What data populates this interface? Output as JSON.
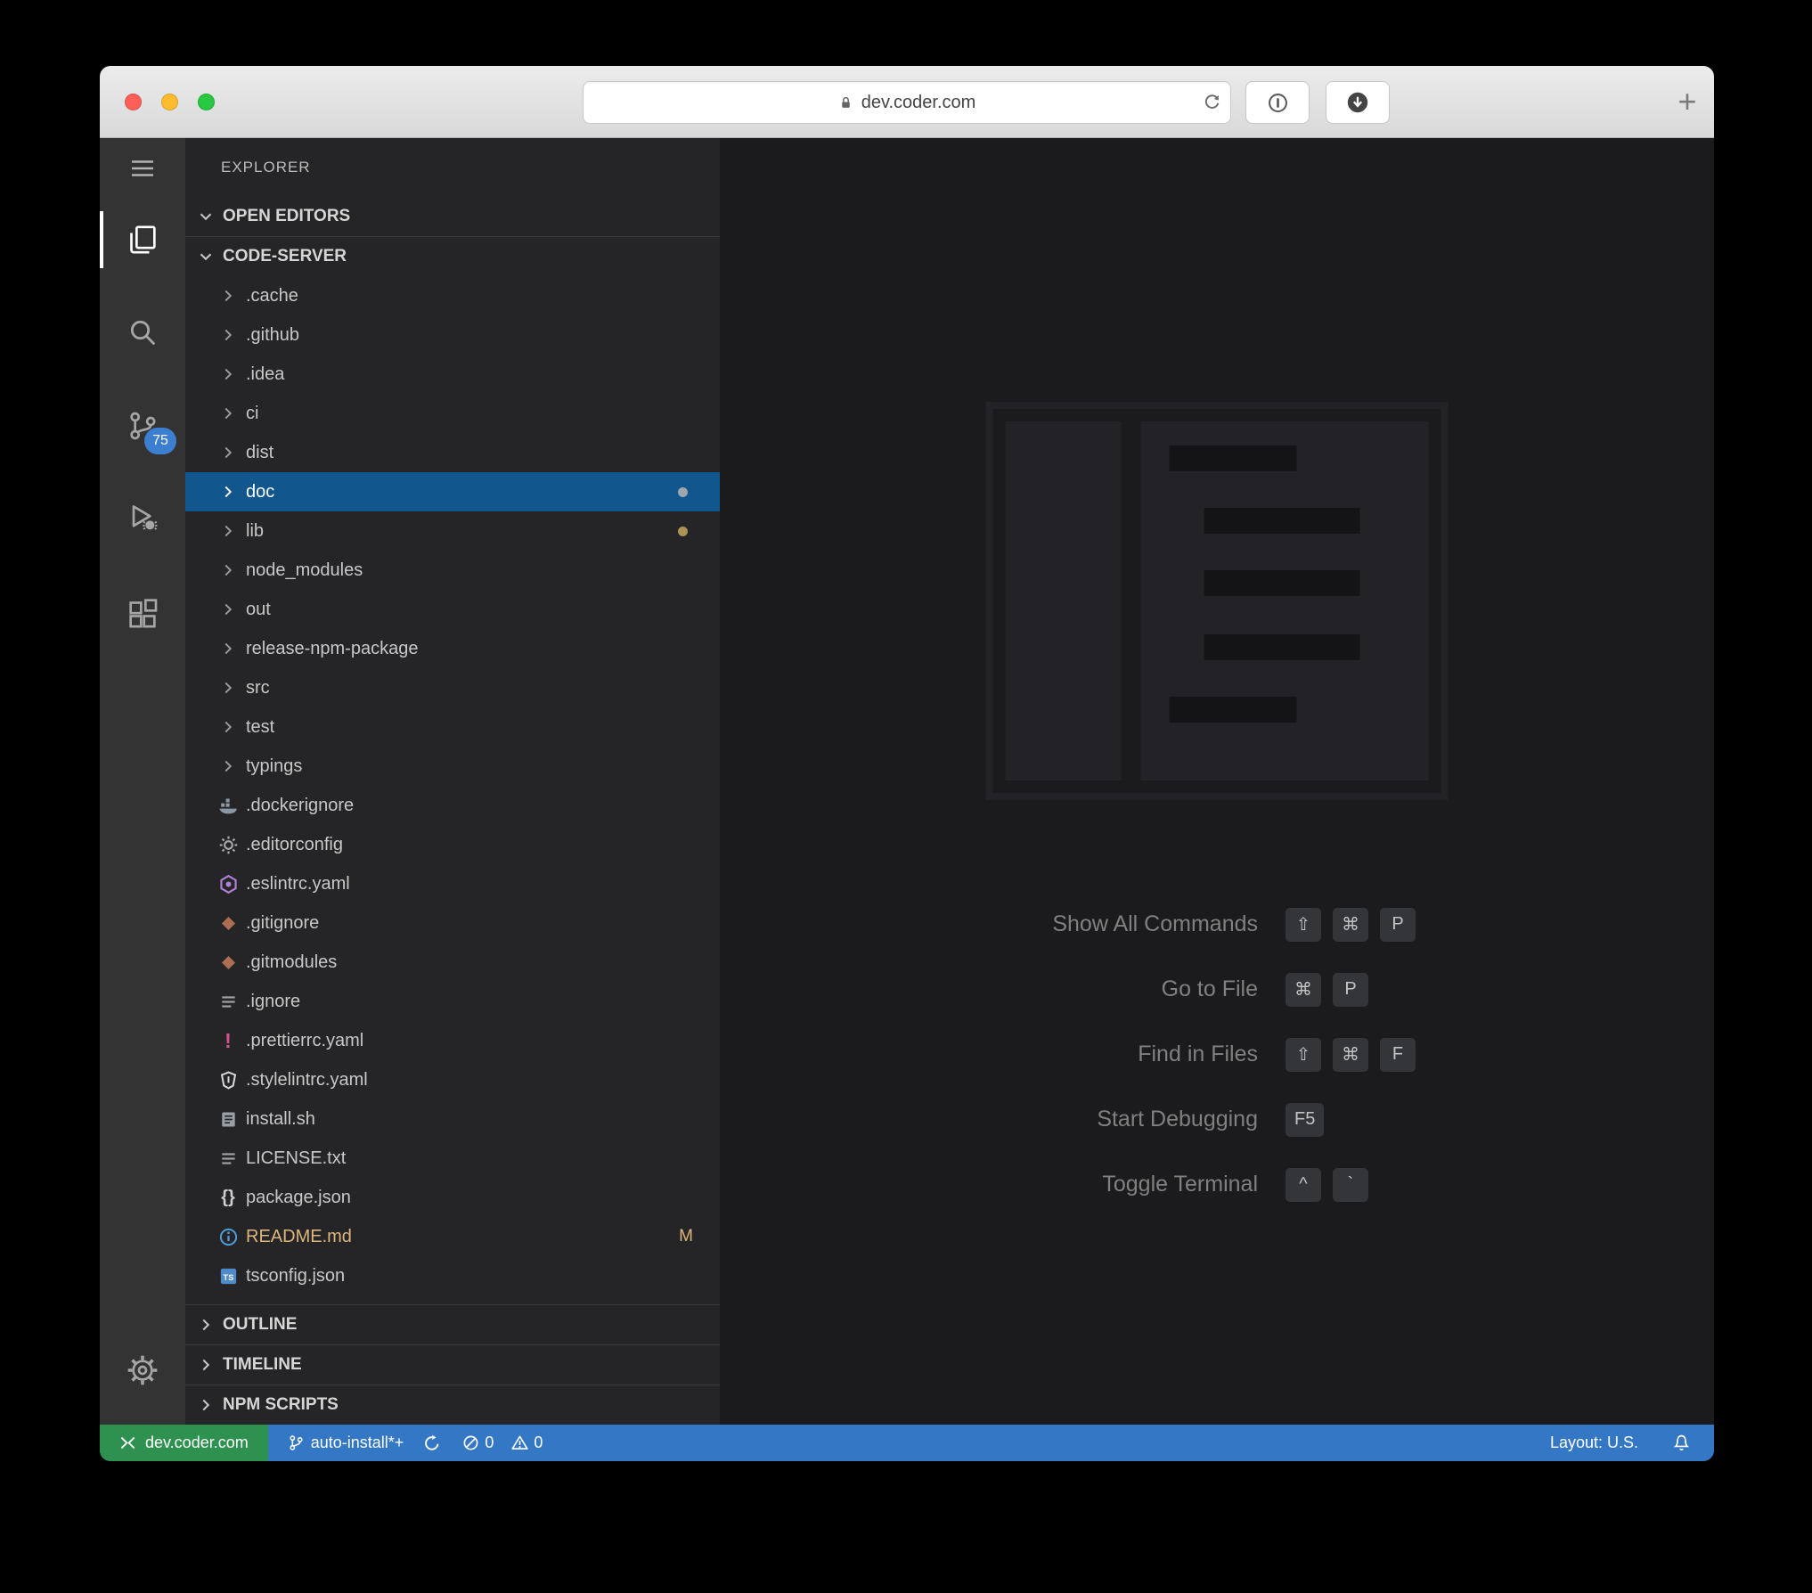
{
  "browser": {
    "url": "dev.coder.com",
    "new_tab_label": "+"
  },
  "activity_bar": {
    "scm_badge": "75"
  },
  "explorer": {
    "title": "EXPLORER",
    "open_editors_label": "OPEN EDITORS",
    "root_label": "CODE-SERVER",
    "items": [
      {
        "label": ".cache",
        "kind": "folder"
      },
      {
        "label": ".github",
        "kind": "folder"
      },
      {
        "label": ".idea",
        "kind": "folder"
      },
      {
        "label": "ci",
        "kind": "folder"
      },
      {
        "label": "dist",
        "kind": "folder"
      },
      {
        "label": "doc",
        "kind": "folder",
        "selected": true,
        "dot": "#9fa6ad"
      },
      {
        "label": "lib",
        "kind": "folder",
        "dot": "#ab9355"
      },
      {
        "label": "node_modules",
        "kind": "folder"
      },
      {
        "label": "out",
        "kind": "folder"
      },
      {
        "label": "release-npm-package",
        "kind": "folder"
      },
      {
        "label": "src",
        "kind": "folder"
      },
      {
        "label": "test",
        "kind": "folder"
      },
      {
        "label": "typings",
        "kind": "folder"
      },
      {
        "label": ".dockerignore",
        "kind": "file",
        "icon": "docker-icon"
      },
      {
        "label": ".editorconfig",
        "kind": "file",
        "icon": "editorconfig-icon"
      },
      {
        "label": ".eslintrc.yaml",
        "kind": "file",
        "icon": "eslint-icon"
      },
      {
        "label": ".gitignore",
        "kind": "file",
        "icon": "git-icon"
      },
      {
        "label": ".gitmodules",
        "kind": "file",
        "icon": "git-icon"
      },
      {
        "label": ".ignore",
        "kind": "file",
        "icon": "list-icon"
      },
      {
        "label": ".prettierrc.yaml",
        "kind": "file",
        "icon": "prettier-icon"
      },
      {
        "label": ".stylelintrc.yaml",
        "kind": "file",
        "icon": "stylelint-icon"
      },
      {
        "label": "install.sh",
        "kind": "file",
        "icon": "script-icon"
      },
      {
        "label": "LICENSE.txt",
        "kind": "file",
        "icon": "list-icon"
      },
      {
        "label": "package.json",
        "kind": "file",
        "icon": "json-icon"
      },
      {
        "label": "README.md",
        "kind": "file",
        "icon": "readme-icon",
        "color": "#ddb67c",
        "badge": "M"
      },
      {
        "label": "tsconfig.json",
        "kind": "file",
        "icon": "ts-icon"
      }
    ],
    "bottom_sections": [
      "OUTLINE",
      "TIMELINE",
      "NPM SCRIPTS"
    ]
  },
  "editor": {
    "shortcuts": [
      {
        "label": "Show All Commands",
        "keys": [
          "⇧",
          "⌘",
          "P"
        ]
      },
      {
        "label": "Go to File",
        "keys": [
          "⌘",
          "P"
        ]
      },
      {
        "label": "Find in Files",
        "keys": [
          "⇧",
          "⌘",
          "F"
        ]
      },
      {
        "label": "Start Debugging",
        "keys": [
          "F5"
        ]
      },
      {
        "label": "Toggle Terminal",
        "keys": [
          "^",
          "`"
        ]
      }
    ]
  },
  "status_bar": {
    "remote_label": "dev.coder.com",
    "branch_label": "auto-install*+",
    "error_count": "0",
    "warning_count": "0",
    "layout_label": "Layout: U.S."
  },
  "colors": {
    "selection_blue": "#11568c",
    "status_blue": "#3477c5",
    "remote_green": "#2e9150",
    "badge_blue": "#3c7fd0",
    "modified_gold": "#ddb67c",
    "doc_dot": "#9fa6ad",
    "lib_dot": "#ab9355"
  }
}
